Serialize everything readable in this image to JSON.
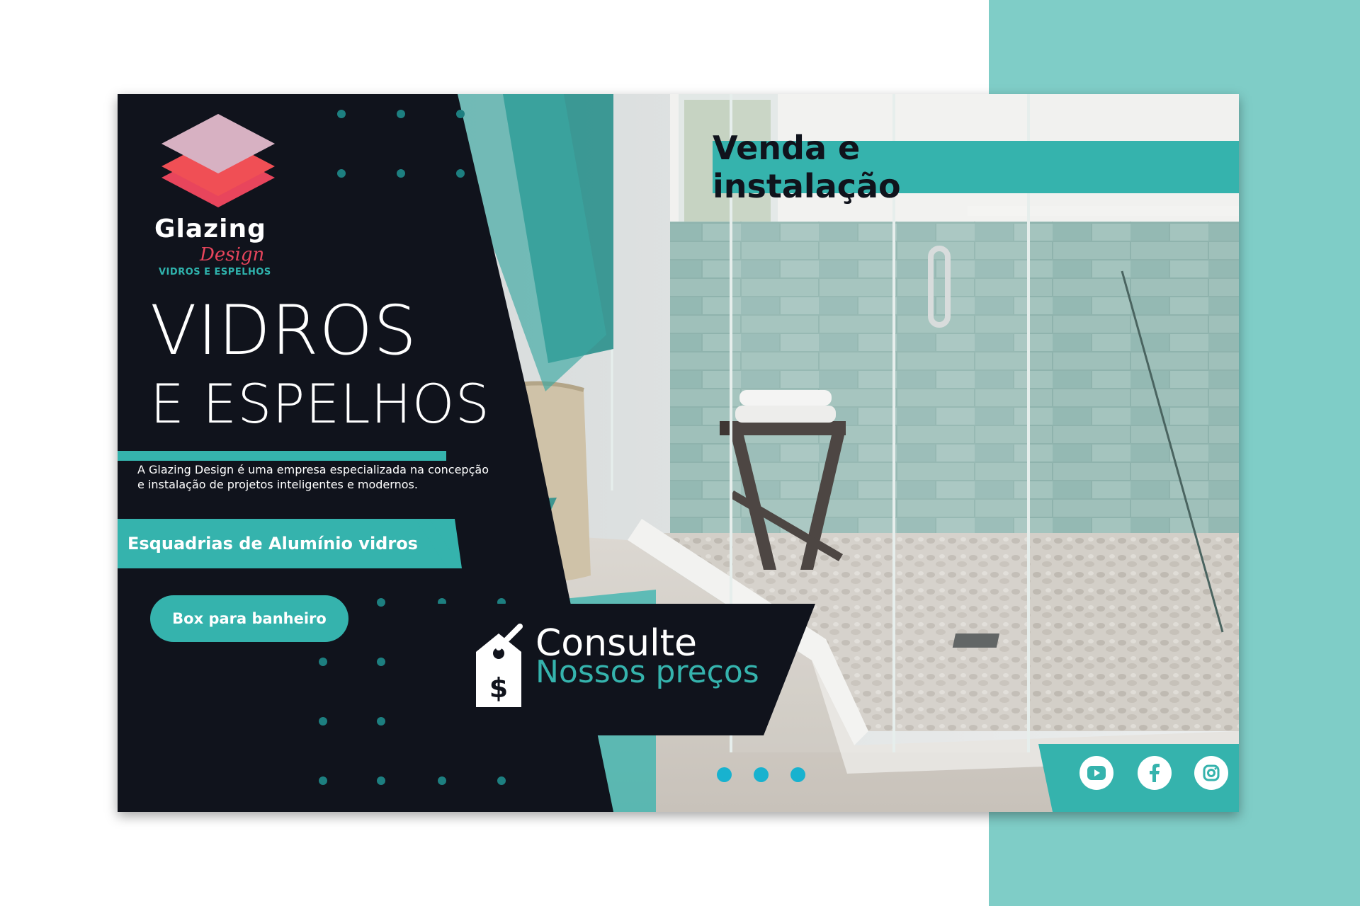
{
  "brand": {
    "name": "Glazing",
    "design": "Design",
    "tagline": "VIDROS E ESPELHOS"
  },
  "hero": {
    "title_line1": "VIDROS",
    "title_line2": "E ESPELHOS",
    "description_line1": "A Glazing Design é uma empresa especializada na concepção",
    "description_line2": "e instalação de projetos inteligentes e modernos."
  },
  "badges": {
    "esquadrias": "Esquadrias de Alumínio vidros",
    "venda": "Venda e instalação"
  },
  "buttons": {
    "box": "Box para banheiro"
  },
  "consult": {
    "line1": "Consulte",
    "line2": "Nossos preços",
    "icon": "price-tag-dollar-icon"
  },
  "carousel": {
    "slide_count": 3
  },
  "social": {
    "icons": [
      "youtube-icon",
      "facebook-icon",
      "instagram-icon"
    ]
  },
  "colors": {
    "dark": "#10131c",
    "teal": "#35b3ad",
    "light_teal": "#7fcdc7",
    "logo_red": "#e8455c",
    "dot_blue": "#18b2cf"
  }
}
